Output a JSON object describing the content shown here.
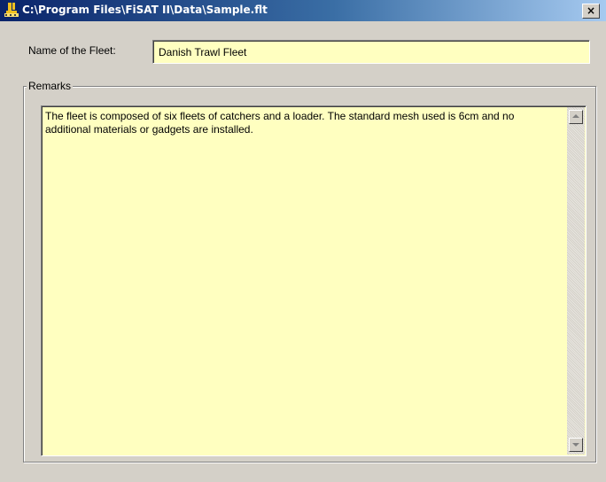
{
  "window": {
    "title": "C:\\Program Files\\FiSAT II\\Data\\Sample.flt",
    "close_label": "×"
  },
  "fleet": {
    "name_label": "Name of the Fleet:",
    "name_value": "Danish Trawl Fleet"
  },
  "remarks": {
    "group_label": "Remarks",
    "text": "The fleet is composed of six fleets of catchers and a loader. The standard mesh used is 6cm and no additional materials or gadgets are installed."
  },
  "colors": {
    "field_background": "#ffffc0",
    "titlebar_start": "#0a246a",
    "titlebar_end": "#a6caf0",
    "window_background": "#d4d0c8"
  }
}
